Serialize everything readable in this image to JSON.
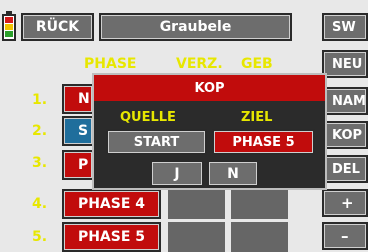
{
  "header": {
    "back_label": "RÜCK",
    "title": "Graubele",
    "battery_colors": [
      "#d51a1a",
      "#f0c400",
      "#2aa02a"
    ]
  },
  "side_buttons": [
    "SW",
    "NEU",
    "NAM",
    "KOP",
    "DEL",
    "+",
    "–"
  ],
  "columns": {
    "phase": "PHASE",
    "delay": "VERZ.",
    "gear": "GEB"
  },
  "rows": [
    {
      "num": "1.",
      "label": "N"
    },
    {
      "num": "2.",
      "label": "S"
    },
    {
      "num": "3.",
      "label": "P"
    },
    {
      "num": "4.",
      "label": "PHASE 4"
    },
    {
      "num": "5.",
      "label": "PHASE 5"
    }
  ],
  "dialog": {
    "title": "KOP",
    "source_label": "QUELLE",
    "target_label": "ZIEL",
    "source_value": "START",
    "target_value": "PHASE 5",
    "yes_label": "J",
    "no_label": "N"
  }
}
